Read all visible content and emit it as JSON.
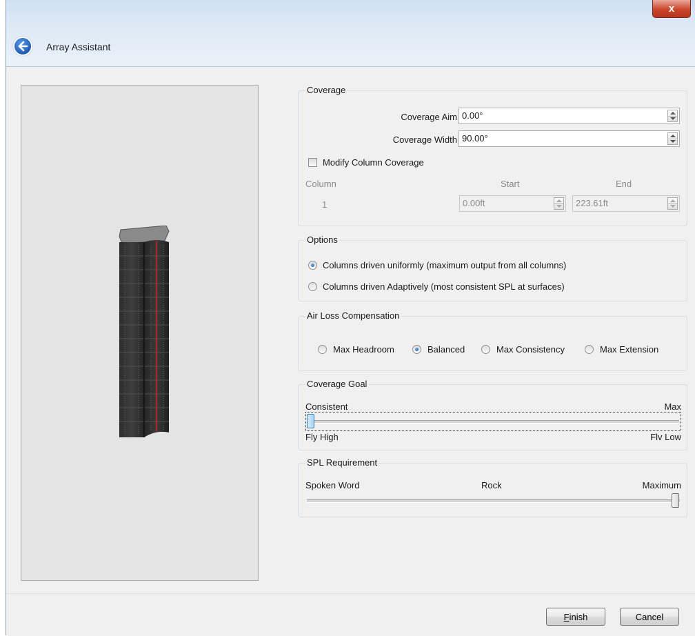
{
  "window": {
    "title": "Array Assistant",
    "close_label": "x"
  },
  "coverage": {
    "legend": "Coverage",
    "aim_label": "Coverage Aim",
    "aim_value": "0.00°",
    "width_label": "Coverage Width",
    "width_value": "90.00°",
    "modify_label": "Modify Column Coverage",
    "modify_checked": false,
    "col_header": "Column",
    "start_header": "Start",
    "end_header": "End",
    "rows": [
      {
        "column": "1",
        "start": "0.00ft",
        "end": "223.61ft"
      }
    ]
  },
  "options": {
    "legend": "Options",
    "uniform_label": "Columns driven uniformly (maximum output from all columns)",
    "adaptive_label": "Columns driven Adaptively (most consistent SPL at surfaces)",
    "selected": "uniform"
  },
  "air_loss": {
    "legend": "Air Loss Compensation",
    "choices": [
      "Max Headroom",
      "Balanced",
      "Max Consistency",
      "Max Extension"
    ],
    "selected": "Balanced"
  },
  "coverage_goal": {
    "legend": "Coverage Goal",
    "left_top": "Consistent",
    "right_top": "Max",
    "left_bottom": "Fly High",
    "right_bottom": "Flv Low",
    "value_fraction": 0.0
  },
  "spl": {
    "legend": "SPL Requirement",
    "left": "Spoken Word",
    "center": "Rock",
    "right": "Maximum",
    "value_fraction": 1.0
  },
  "footer": {
    "finish_label": "inish",
    "finish_mnemonic": "F",
    "cancel_label": "Cancel"
  }
}
